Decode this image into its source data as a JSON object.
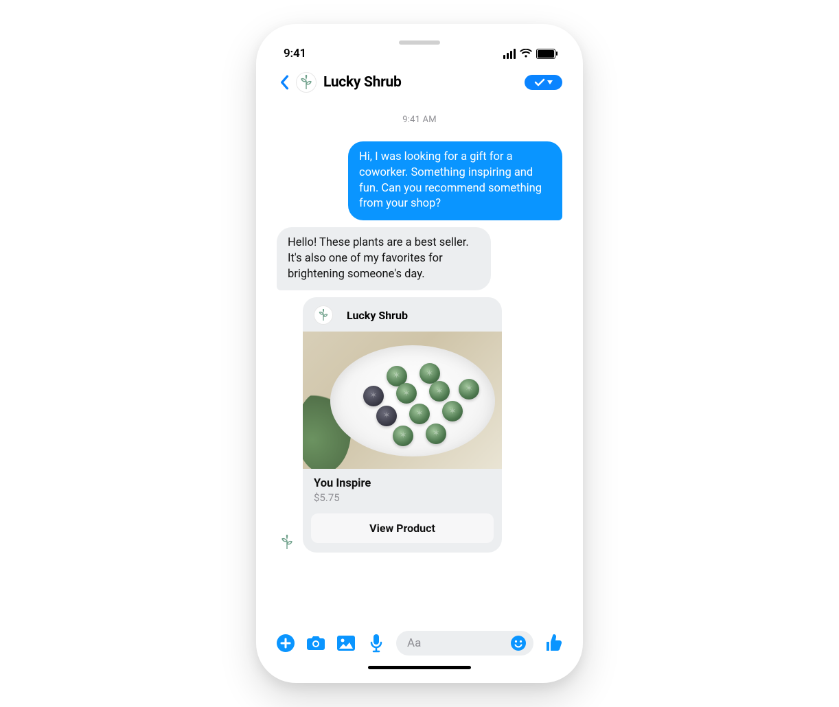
{
  "status": {
    "time": "9:41"
  },
  "header": {
    "title": "Lucky Shrub"
  },
  "thread": {
    "timestamp": "9:41 AM",
    "user_message": "Hi, I was looking for a gift for a coworker. Something inspiring and fun. Can you recommend something from your shop?",
    "bot_message": "Hello! These plants are a best seller. It's also one of my favorites for brightening someone's day."
  },
  "product_card": {
    "sender": "Lucky Shrub",
    "title": "You Inspire",
    "price": "$5.75",
    "button": "View Product"
  },
  "composer": {
    "placeholder": "Aa"
  },
  "colors": {
    "accent": "#0a95ff",
    "bubble_in": "#eceef0"
  }
}
